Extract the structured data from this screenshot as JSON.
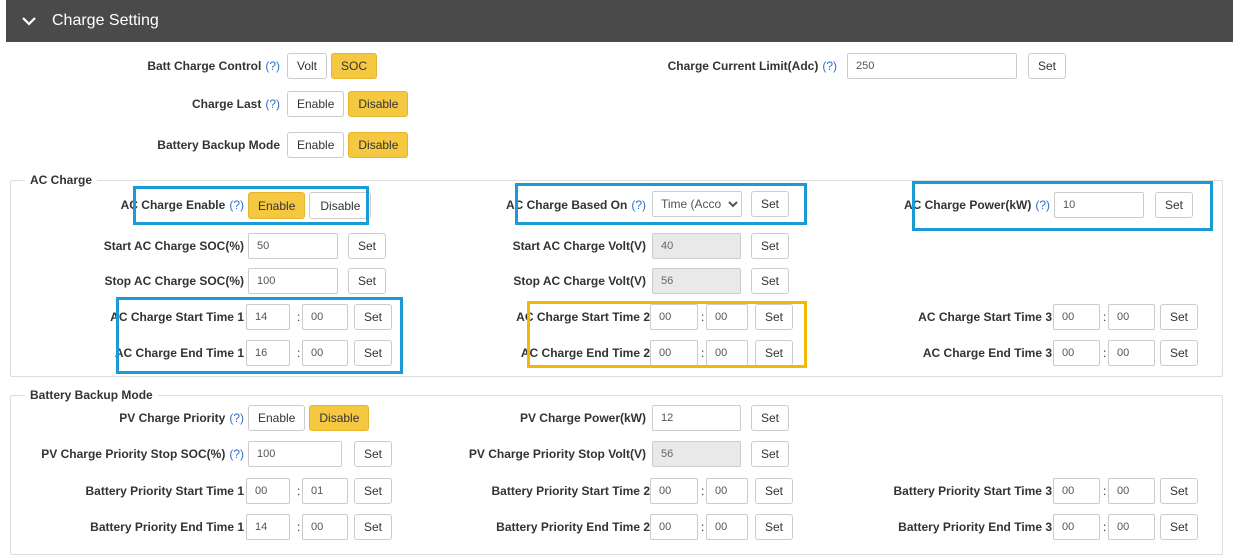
{
  "header": {
    "title": "Charge Setting"
  },
  "help_mark": "(?)",
  "set_label": "Set",
  "colon": ":",
  "top": {
    "batt_charge_control": {
      "label": "Batt Charge Control",
      "opt1": "Volt",
      "opt2": "SOC",
      "selected": "SOC"
    },
    "charge_last": {
      "label": "Charge Last",
      "opt1": "Enable",
      "opt2": "Disable",
      "selected": "Disable"
    },
    "battery_backup_mode": {
      "label": "Battery Backup Mode",
      "opt1": "Enable",
      "opt2": "Disable",
      "selected": "Disable"
    },
    "charge_current_limit": {
      "label": "Charge Current Limit(Adc)",
      "value": "250"
    }
  },
  "ac_charge": {
    "legend": "AC Charge",
    "enable": {
      "label": "AC Charge Enable",
      "opt1": "Enable",
      "opt2": "Disable",
      "selected": "Enable"
    },
    "based_on": {
      "label": "AC Charge Based On",
      "value": "Time (Acco"
    },
    "power": {
      "label": "AC Charge Power(kW)",
      "value": "10"
    },
    "start_soc": {
      "label": "Start AC Charge SOC(%)",
      "value": "50"
    },
    "stop_soc": {
      "label": "Stop AC Charge SOC(%)",
      "value": "100"
    },
    "start_volt": {
      "label": "Start AC Charge Volt(V)",
      "value": "40"
    },
    "stop_volt": {
      "label": "Stop AC Charge Volt(V)",
      "value": "56"
    },
    "start_time_1": {
      "label": "AC Charge Start Time 1",
      "h": "14",
      "m": "00"
    },
    "end_time_1": {
      "label": "AC Charge End Time 1",
      "h": "16",
      "m": "00"
    },
    "start_time_2": {
      "label": "AC Charge Start Time 2",
      "h": "00",
      "m": "00"
    },
    "end_time_2": {
      "label": "AC Charge End Time 2",
      "h": "00",
      "m": "00"
    },
    "start_time_3": {
      "label": "AC Charge Start Time 3",
      "h": "00",
      "m": "00"
    },
    "end_time_3": {
      "label": "AC Charge End Time 3",
      "h": "00",
      "m": "00"
    }
  },
  "battery_backup": {
    "legend": "Battery Backup Mode",
    "pv_priority": {
      "label": "PV Charge Priority",
      "opt1": "Enable",
      "opt2": "Disable",
      "selected": "Disable"
    },
    "pv_power": {
      "label": "PV Charge Power(kW)",
      "value": "12"
    },
    "pv_stop_soc": {
      "label": "PV Charge Priority Stop SOC(%)",
      "value": "100"
    },
    "pv_stop_volt": {
      "label": "PV Charge Priority Stop Volt(V)",
      "value": "56"
    },
    "start_time_1": {
      "label": "Battery Priority Start Time 1",
      "h": "00",
      "m": "01"
    },
    "end_time_1": {
      "label": "Battery Priority End Time 1",
      "h": "14",
      "m": "00"
    },
    "start_time_2": {
      "label": "Battery Priority Start Time 2",
      "h": "00",
      "m": "00"
    },
    "end_time_2": {
      "label": "Battery Priority End Time 2",
      "h": "00",
      "m": "00"
    },
    "start_time_3": {
      "label": "Battery Priority Start Time 3",
      "h": "00",
      "m": "00"
    },
    "end_time_3": {
      "label": "Battery Priority End Time 3",
      "h": "00",
      "m": "00"
    }
  },
  "colors": {
    "header_bg": "#4a4a4a",
    "active_toggle": "#f5c842",
    "highlight_blue": "#1a9ad6",
    "highlight_yellow": "#f5b800",
    "help_link": "#2f6fd0"
  }
}
